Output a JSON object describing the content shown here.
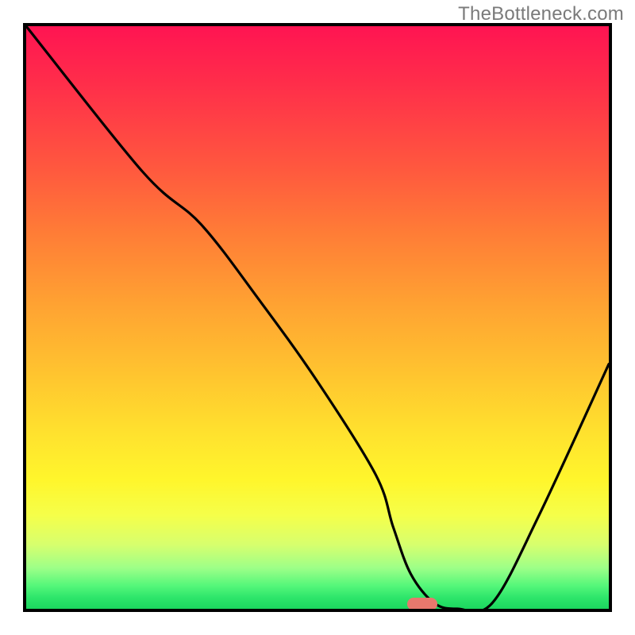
{
  "watermark": "TheBottleneck.com",
  "chart_data": {
    "type": "line",
    "title": "",
    "xlabel": "",
    "ylabel": "",
    "xlim": [
      0,
      100
    ],
    "ylim": [
      0,
      100
    ],
    "grid": false,
    "series": [
      {
        "name": "bottleneck-curve",
        "x": [
          0,
          20,
          30,
          40,
          50,
          60,
          63,
          66,
          70,
          74,
          80,
          88,
          100
        ],
        "values": [
          100,
          75,
          66,
          53,
          39,
          23,
          14,
          6,
          1,
          0,
          1,
          16,
          42
        ]
      }
    ],
    "annotations": [
      {
        "name": "optimum-marker",
        "x": 68,
        "y": 0.8
      }
    ],
    "background_gradient": {
      "top": "#ff1452",
      "upper_mid": "#ff7e36",
      "mid": "#ffe22e",
      "lower_mid": "#9dff88",
      "bottom": "#1bd65f"
    }
  }
}
